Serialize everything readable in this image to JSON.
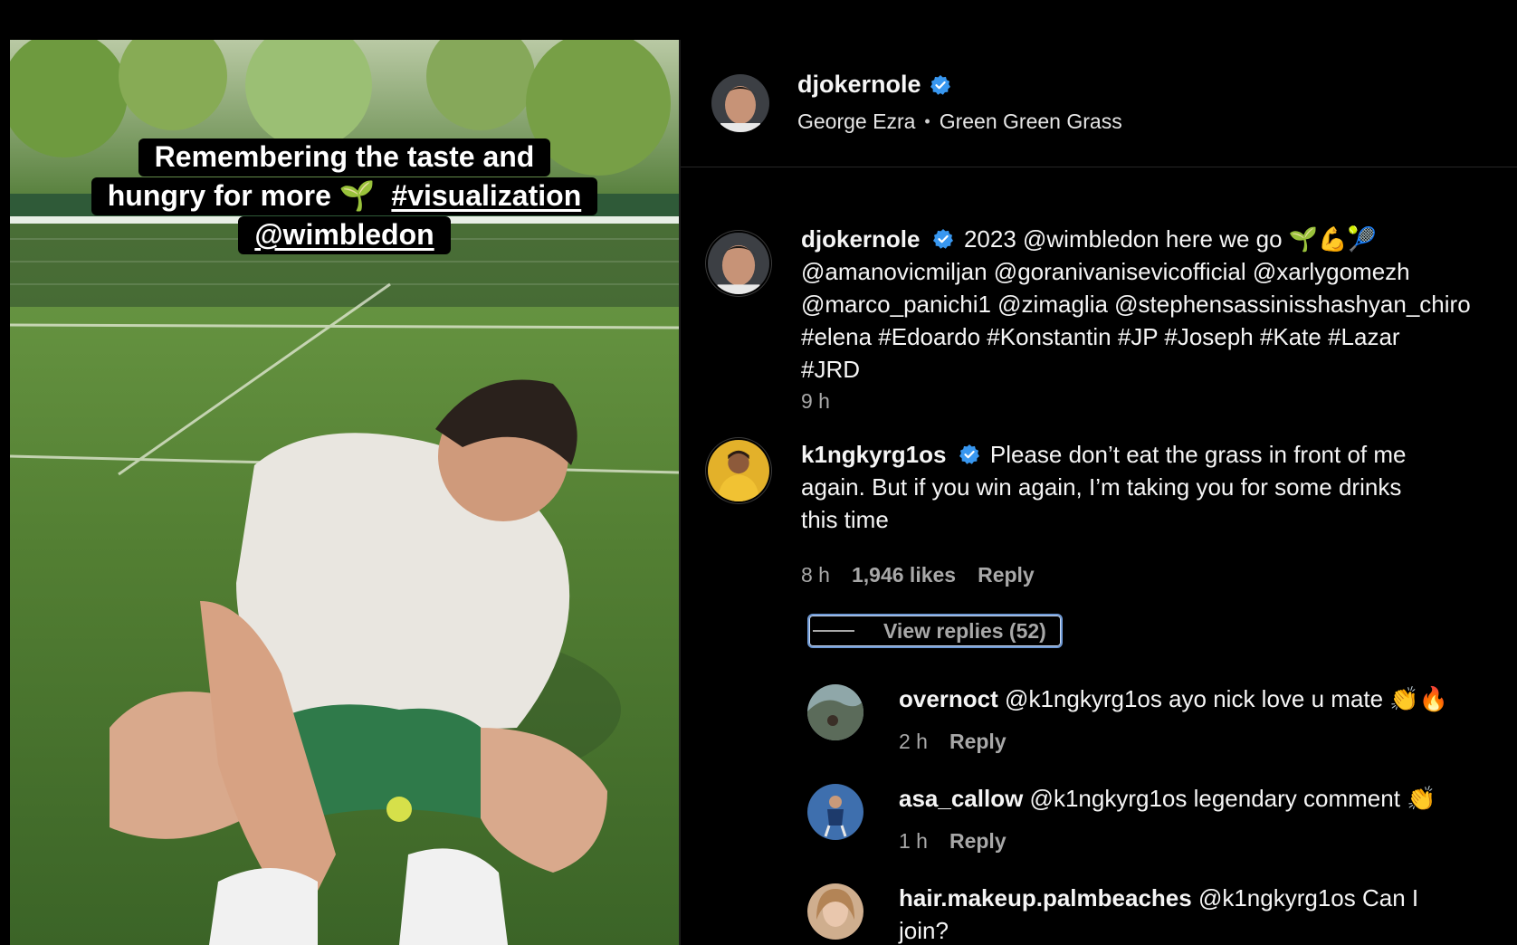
{
  "story": {
    "caption_line1": "Remembering the taste and",
    "caption_line2_text": "hungry for more",
    "caption_line2_emoji": "🌱",
    "caption_hashtag": "#visualization",
    "caption_mention": "@wimbledon"
  },
  "header": {
    "username": "djokernole",
    "music_artist": "George Ezra",
    "music_separator": "•",
    "music_title": "Green Green Grass"
  },
  "post_caption": {
    "username": "djokernole",
    "text": "2023 @wimbledon here we go 🌱💪🎾",
    "line2": "@amanovicmiljan @goranivanisevicofficial @xarlygomezh",
    "line3": "@marco_panichi1 @zimaglia @stephensassinisshashyan_chiro",
    "line4": "#elena #Edoardo #Konstantin #JP #Joseph #Kate #Lazar",
    "line5": "#JRD",
    "time": "9 h"
  },
  "comments": [
    {
      "username": "k1ngkyrg1os",
      "verified": true,
      "text_line1": "Please don’t eat the grass in front of me",
      "text_line2": "again. But if you win again, I’m taking you for some drinks",
      "text_line3": "this time",
      "time": "8 h",
      "likes": "1,946 likes",
      "reply_label": "Reply",
      "view_replies": "View replies (52)"
    }
  ],
  "replies": [
    {
      "username": "overnoct",
      "text": "@k1ngkyrg1os ayo nick love u mate 👏🔥",
      "time": "2 h",
      "reply_label": "Reply"
    },
    {
      "username": "asa_callow",
      "text": "@k1ngkyrg1os legendary comment 👏",
      "time": "1 h",
      "reply_label": "Reply"
    },
    {
      "username": "hair.makeup.palmbeaches",
      "text": "@k1ngkyrg1os Can I",
      "text_line2": "join?"
    }
  ],
  "colors": {
    "background": "#000000",
    "verified_badge": "#3897f0",
    "meta_text": "#a8a8a8",
    "focus_outline": "#6f9ad6"
  }
}
